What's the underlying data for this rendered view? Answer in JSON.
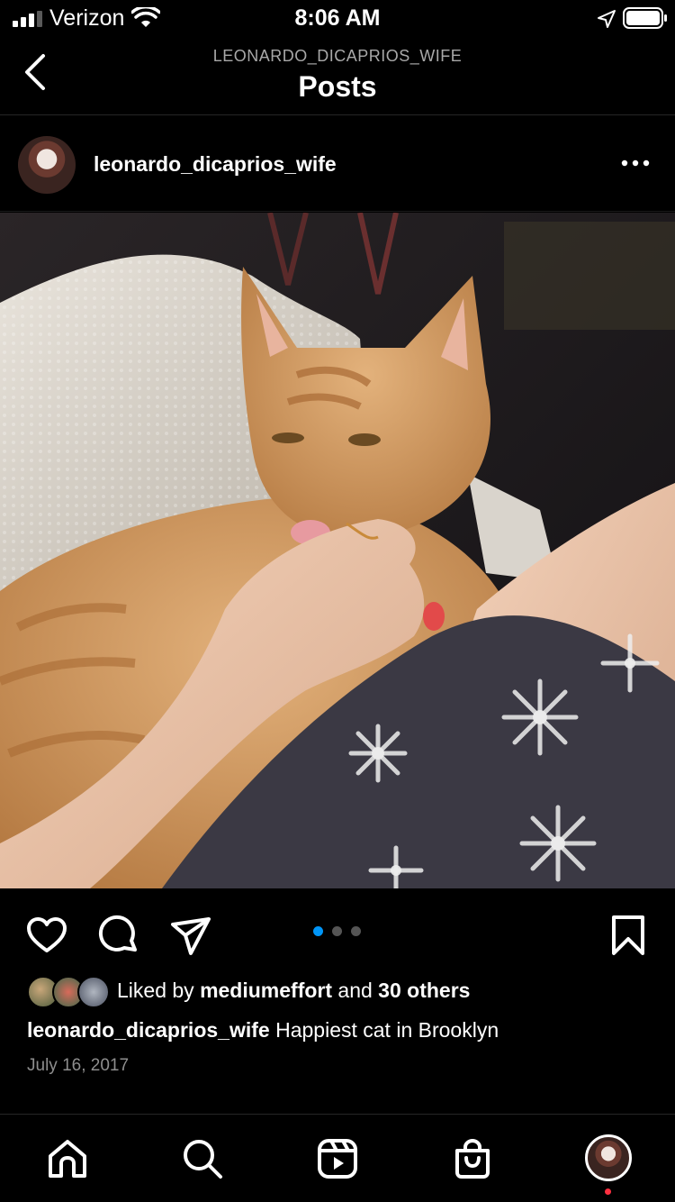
{
  "status_bar": {
    "carrier": "Verizon",
    "time": "8:06 AM"
  },
  "header": {
    "account": "LEONARDO_DICAPRIOS_WIFE",
    "title": "Posts"
  },
  "post": {
    "username": "leonardo_dicaprios_wife",
    "photo_description_icon": "photo-icon",
    "carousel": {
      "count": 3,
      "active_index": 0,
      "active_color": "#0095f6"
    },
    "likes": {
      "prefix": "Liked by",
      "liked_by_user": "mediumeffort",
      "middle": "and",
      "others": "30 others"
    },
    "caption": {
      "username": "leonardo_dicaprios_wife",
      "text": "Happiest cat in Brooklyn"
    },
    "date": "July 16, 2017"
  },
  "colors": {
    "background": "#000000",
    "text": "#ffffff",
    "secondary_text": "#8e8e8e",
    "accent": "#0095f6",
    "notification": "#ff3040"
  },
  "icons": {
    "back": "chevron-left-icon",
    "more": "more-horizontal-icon",
    "like": "heart-icon",
    "comment": "comment-icon",
    "share": "paper-plane-icon",
    "save": "bookmark-icon",
    "tabs": [
      "home-icon",
      "search-icon",
      "reels-icon",
      "shop-icon",
      "profile-avatar"
    ]
  }
}
